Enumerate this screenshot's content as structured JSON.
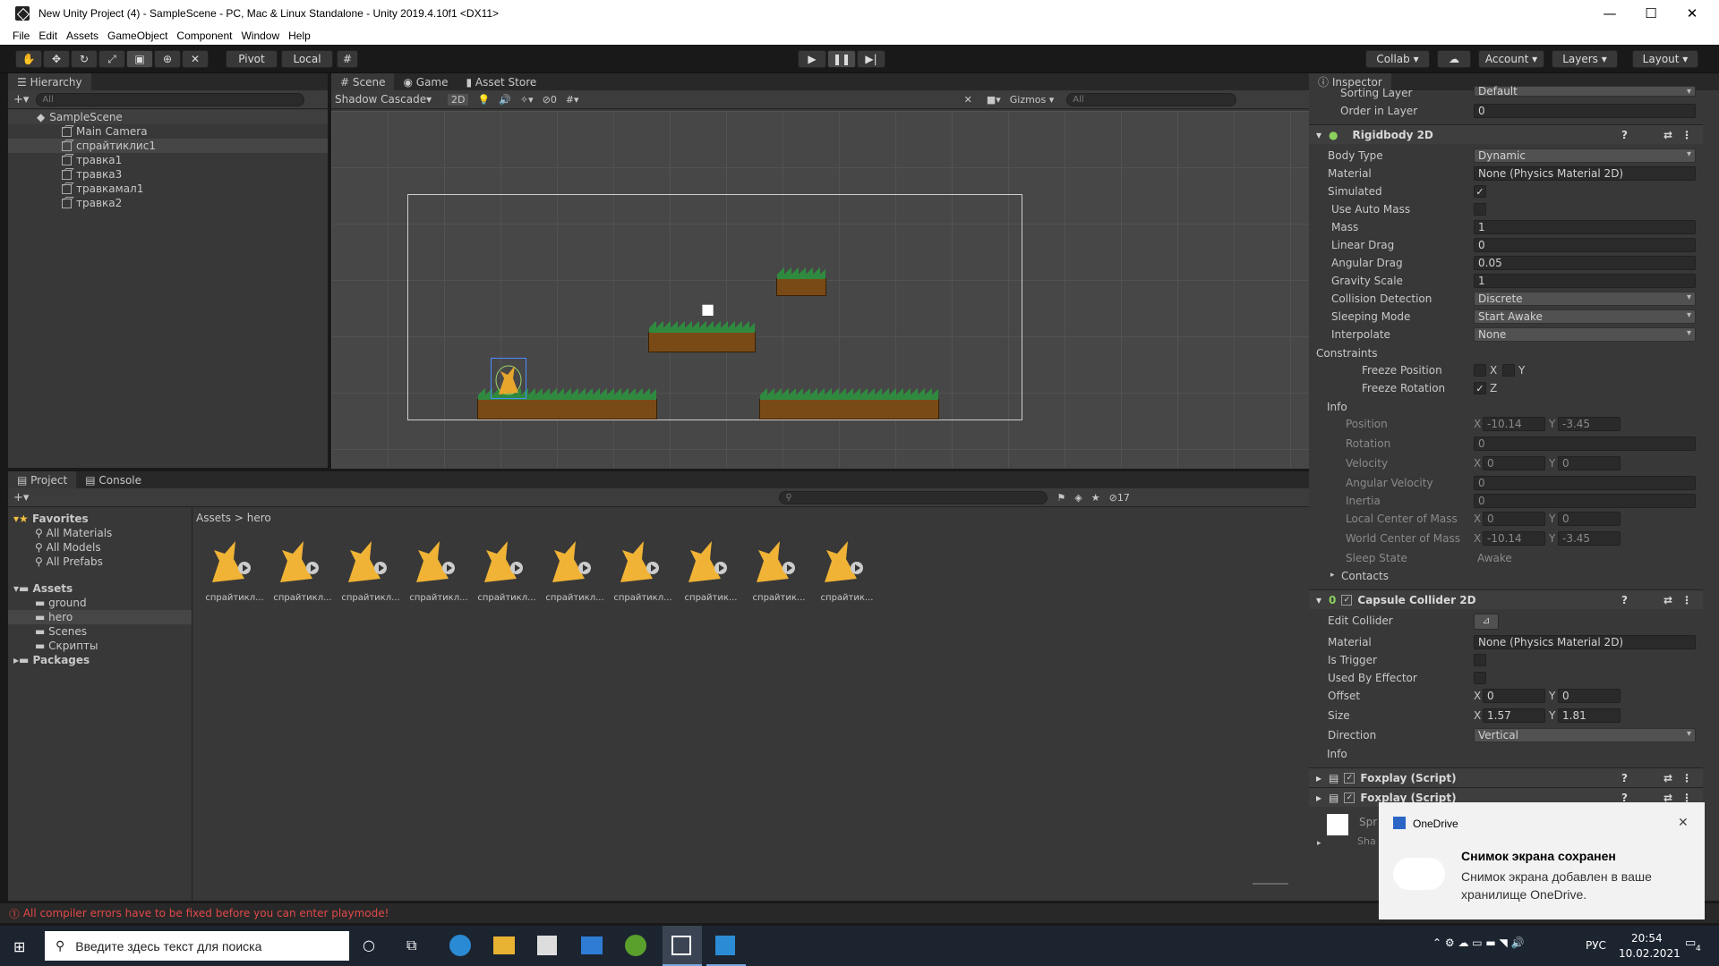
{
  "window": {
    "title": "New Unity Project (4) - SampleScene - PC, Mac & Linux Standalone - Unity 2019.4.10f1 <DX11>",
    "minimize": "—",
    "maximize": "☐",
    "close": "✕"
  },
  "menu": [
    "File",
    "Edit",
    "Assets",
    "GameObject",
    "Component",
    "Window",
    "Help"
  ],
  "toolbar": {
    "pivot": "Pivot",
    "local": "Local",
    "collab": "Collab",
    "account": "Account",
    "layers": "Layers",
    "layout": "Layout"
  },
  "hierarchy": {
    "tab": "Hierarchy",
    "search": "All",
    "scene": "SampleScene",
    "items": [
      "Main Camera",
      "спрайтиклис1",
      "травка1",
      "травка3",
      "травкамал1",
      "травка2"
    ]
  },
  "sceneTabs": {
    "scene": "Scene",
    "game": "Game",
    "store": "Asset Store",
    "shading": "Shadow Cascade",
    "mode2d": "2D",
    "hidden": "0",
    "gizmos": "Gizmos",
    "search": "All"
  },
  "project": {
    "tab": "Project",
    "console": "Console",
    "count": "17",
    "breadcrumb": [
      "Assets",
      "hero"
    ],
    "favorites": {
      "label": "Favorites",
      "items": [
        "All Materials",
        "All Models",
        "All Prefabs"
      ]
    },
    "assets": {
      "label": "Assets",
      "items": [
        "ground",
        "hero",
        "Scenes",
        "Скрипты"
      ]
    },
    "packages": "Packages",
    "files": [
      "спрайтикл...",
      "спрайтикл...",
      "спрайтикл...",
      "спрайтикл...",
      "спрайтикл...",
      "спрайтикл...",
      "спрайтикл...",
      "спрайтик...",
      "спрайтик...",
      "спрайтик..."
    ]
  },
  "inspector": {
    "tab": "Inspector",
    "sortingLayer": {
      "label": "Sorting Layer",
      "value": "Default"
    },
    "orderInLayer": {
      "label": "Order in Layer",
      "value": "0"
    },
    "rigidbody": {
      "title": "Rigidbody 2D",
      "bodyType": {
        "label": "Body Type",
        "value": "Dynamic"
      },
      "material": {
        "label": "Material",
        "value": "None (Physics Material 2D)"
      },
      "simulated": {
        "label": "Simulated",
        "value": "✓"
      },
      "autoMass": {
        "label": "Use Auto Mass"
      },
      "mass": {
        "label": "Mass",
        "value": "1"
      },
      "linearDrag": {
        "label": "Linear Drag",
        "value": "0"
      },
      "angularDrag": {
        "label": "Angular Drag",
        "value": "0.05"
      },
      "gravity": {
        "label": "Gravity Scale",
        "value": "1"
      },
      "collision": {
        "label": "Collision Detection",
        "value": "Discrete"
      },
      "sleeping": {
        "label": "Sleeping Mode",
        "value": "Start Awake"
      },
      "interpolate": {
        "label": "Interpolate",
        "value": "None"
      },
      "constraints": "Constraints",
      "freezePos": {
        "label": "Freeze Position",
        "x": "X",
        "y": "Y"
      },
      "freezeRot": {
        "label": "Freeze Rotation",
        "z": "Z",
        "check": "✓"
      },
      "info": "Info",
      "position": {
        "label": "Position",
        "x": "-10.14",
        "y": "-3.45"
      },
      "rotation": {
        "label": "Rotation",
        "value": "0"
      },
      "velocity": {
        "label": "Velocity",
        "x": "0",
        "y": "0"
      },
      "angVel": {
        "label": "Angular Velocity",
        "value": "0"
      },
      "inertia": {
        "label": "Inertia",
        "value": "0"
      },
      "localCom": {
        "label": "Local Center of Mass",
        "x": "0",
        "y": "0"
      },
      "worldCom": {
        "label": "World Center of Mass",
        "x": "-10.14",
        "y": "-3.45"
      },
      "sleepState": {
        "label": "Sleep State",
        "value": "Awake"
      },
      "contacts": "Contacts"
    },
    "capsule": {
      "title": "Capsule Collider 2D",
      "edit": {
        "label": "Edit Collider"
      },
      "material": {
        "label": "Material",
        "value": "None (Physics Material 2D)"
      },
      "trigger": {
        "label": "Is Trigger"
      },
      "effector": {
        "label": "Used By Effector"
      },
      "offset": {
        "label": "Offset",
        "x": "0",
        "y": "0"
      },
      "size": {
        "label": "Size",
        "x": "1.57",
        "y": "1.81"
      },
      "direction": {
        "label": "Direction",
        "value": "Vertical"
      },
      "info": "Info"
    },
    "script1": "Foxplay (Script)",
    "script2": "Foxplay (Script)",
    "spr": "Spr",
    "sha": "Sha"
  },
  "status": "All compiler errors have to be fixed before you can enter playmode!",
  "toast": {
    "app": "OneDrive",
    "title": "Снимок экрана сохранен",
    "body": "Снимок экрана добавлен в ваше хранилище OneDrive."
  },
  "taskbar": {
    "search": "Введите здесь текст для поиска",
    "lang": "РУС",
    "time": "20:54",
    "date": "10.02.2021",
    "notif": "4"
  },
  "axis": {
    "x": "X",
    "y": "Y"
  }
}
